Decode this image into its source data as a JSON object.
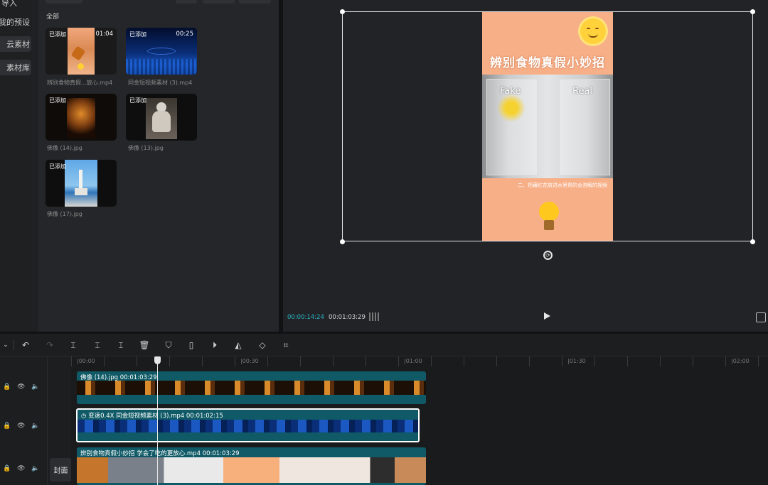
{
  "nav": {
    "items": [
      "导入",
      "我的预设",
      "云素材",
      "素材库"
    ]
  },
  "media": {
    "section_label": "全部",
    "items": [
      {
        "badge": "已添加",
        "duration": "01:04",
        "name": "辨别食物真假...放心.mp4"
      },
      {
        "badge": "已添加",
        "duration": "00:25",
        "name": "同金短视频素材 (3).mp4"
      },
      {
        "badge": "已添加",
        "duration": "",
        "name": "佛像 (14).jpg"
      },
      {
        "badge": "已添加",
        "duration": "",
        "name": "佛像 (13).jpg"
      },
      {
        "badge": "已添加",
        "duration": "",
        "name": "佛像 (17).jpg"
      }
    ]
  },
  "preview": {
    "title_text": "辨别食物真假小妙招",
    "fake_label": "Fake",
    "real_label": "Real",
    "caption": "二、把藏红花放进水里帮的会溶解的视频",
    "current_time": "00:00:14:24",
    "total_time": "00:01:03:29"
  },
  "timeline": {
    "ruler": [
      "|00:00",
      "|00:30",
      "|01:00",
      "|01:30",
      "|02:00"
    ],
    "tracks": [
      {
        "label": "佛像 (14).jpg   00:01:03:29"
      },
      {
        "speed": "变速0.4X",
        "label": "同金短视频素材 (3).mp4   00:01:02:15"
      },
      {
        "label": "辨别食物真假小妙招 学会了吃的更放心.mp4   00:01:03:29"
      }
    ],
    "cover_label": "封面"
  },
  "colors": {
    "accent": "#2ab7c9",
    "clip_teal": "#0f5a66",
    "preview_bg": "#f8b08a"
  }
}
